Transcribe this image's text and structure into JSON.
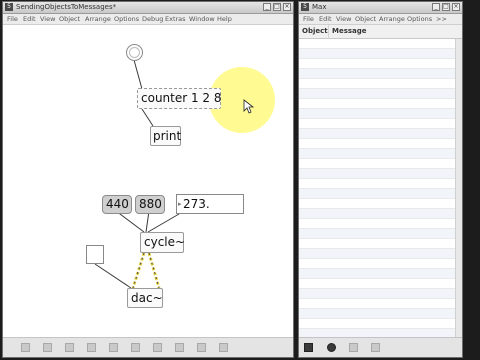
{
  "patcher": {
    "badge": "5",
    "title": "SendingObjectsToMessages*",
    "menu": [
      "File",
      "Edit",
      "View",
      "Object",
      "Arrange",
      "Options",
      "Debug",
      "Extras",
      "Window",
      "Help"
    ],
    "objects": {
      "counter": "counter 1 2 8",
      "print": "print",
      "msg440": "440",
      "msg880": "880",
      "number": "273.",
      "cycle": "cycle~",
      "dac": "dac~"
    }
  },
  "max_window": {
    "badge": "5",
    "title": "Max",
    "menu": [
      "File",
      "Edit",
      "View",
      "Object",
      "Arrange",
      "Options",
      ">>"
    ],
    "columns": {
      "object": "Object",
      "message": "Message"
    }
  },
  "colors": {
    "highlight": "#fff98c",
    "patch_cord_signal": "#e8d64a"
  }
}
